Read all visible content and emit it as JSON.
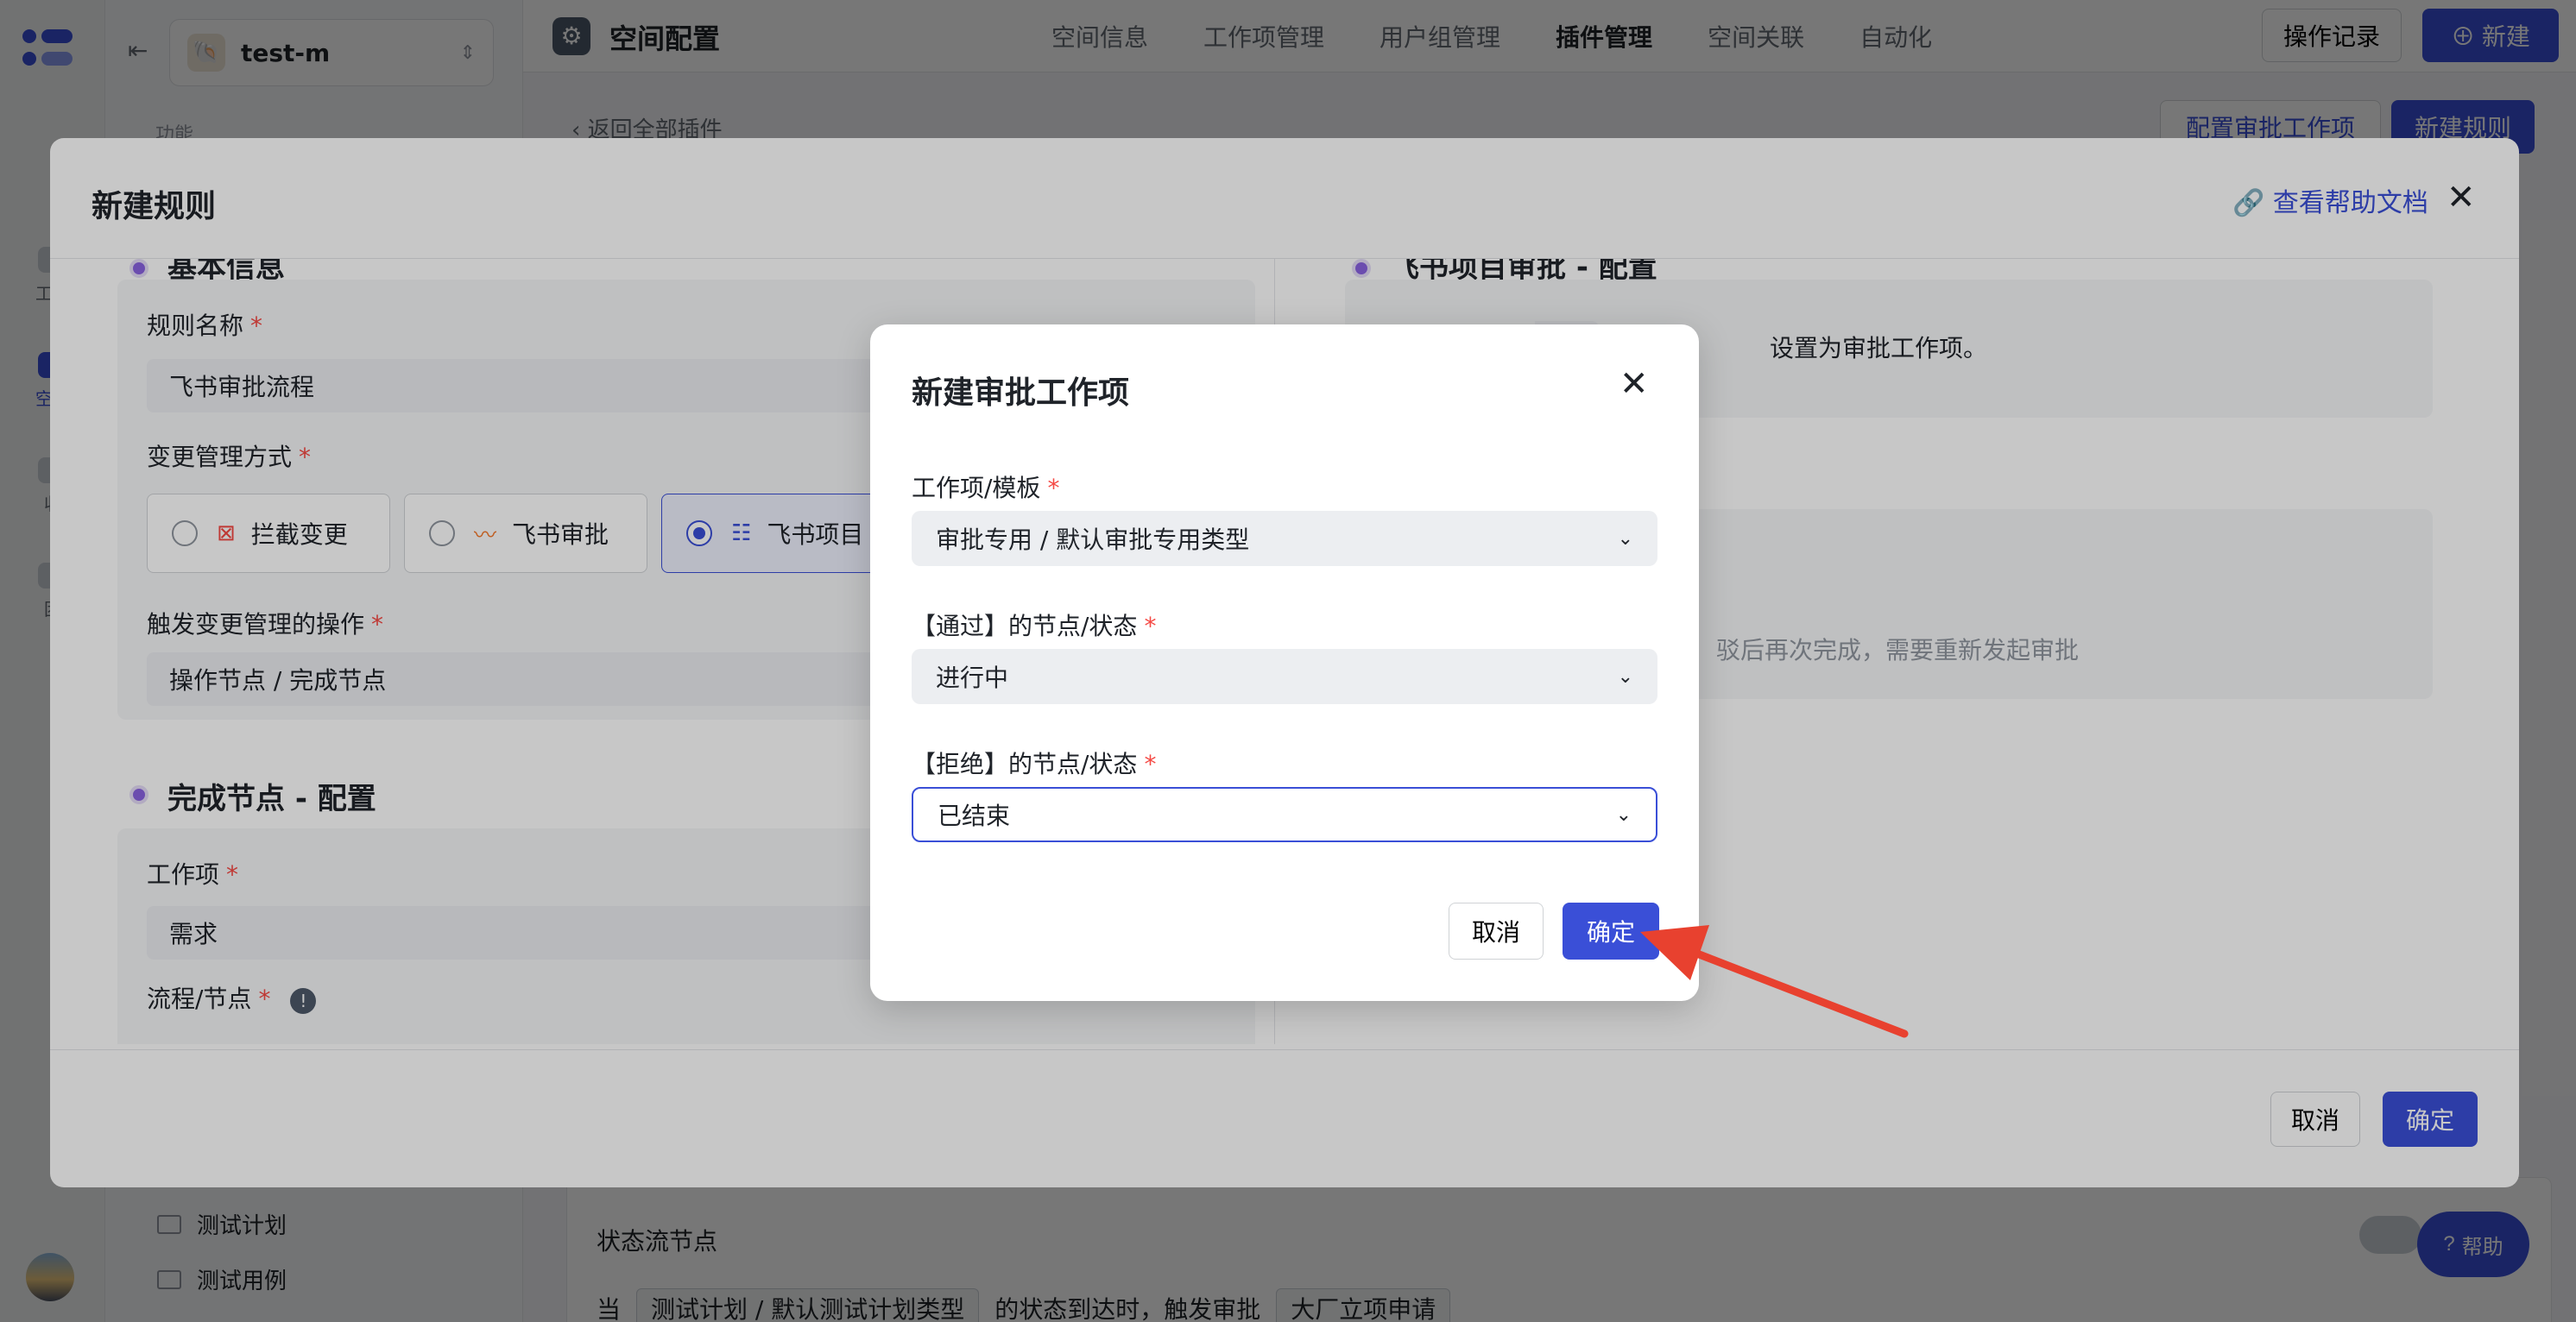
{
  "sidebar": {
    "space_name": "test-m",
    "section_label": "功能",
    "rail_items": [
      "工作",
      "空间",
      "收",
      "团"
    ],
    "tree_items": [
      "测试计划",
      "测试用例"
    ]
  },
  "topbar": {
    "title": "空间配置",
    "tabs": [
      "空间信息",
      "工作项管理",
      "用户组管理",
      "插件管理",
      "空间关联",
      "自动化"
    ],
    "active_tab": "插件管理",
    "log_button": "操作记录",
    "new_button": "新建"
  },
  "crumb": {
    "back": "返回全部插件",
    "config_button": "配置审批工作项",
    "new_rule_button": "新建规则"
  },
  "background_rule": {
    "heading": "状态流节点",
    "sentence_prefix": "当",
    "tag1": "测试计划 / 默认测试计划类型",
    "sentence_mid": "的状态到达时，触发审批",
    "tag2": "大厂立项申请"
  },
  "help_button": "帮助",
  "rule_dialog": {
    "title": "新建规则",
    "help_link": "查看帮助文档",
    "basic_section": "基本信息",
    "rule_name_label": "规则名称",
    "rule_name_value": "飞书审批流程",
    "change_mode_label": "变更管理方式",
    "mode_options": [
      "拦截变更",
      "飞书审批",
      "飞书项目"
    ],
    "selected_mode": "飞书项目",
    "trigger_label": "触发变更管理的操作",
    "trigger_value": "操作节点 / 完成节点",
    "complete_section": "完成节点 - 配置",
    "work_item_label": "工作项",
    "work_item_value": "需求",
    "flow_node_label": "流程/节点",
    "right_section": "飞书项目审批 - 配置",
    "right_text1": "设置为审批工作项。",
    "right_text2": "驳后再次完成，需要重新发起审批",
    "cancel": "取消",
    "confirm": "确定"
  },
  "approval_dialog": {
    "title": "新建审批工作项",
    "template_label": "工作项/模板",
    "template_value": "审批专用 / 默认审批专用类型",
    "pass_label": "【通过】的节点/状态",
    "pass_value": "进行中",
    "reject_label": "【拒绝】的节点/状态",
    "reject_value": "已结束",
    "cancel": "取消",
    "confirm": "确定"
  },
  "colors": {
    "primary": "#3a4fd7",
    "required": "#f54a45",
    "section_dot": "#8a62e0",
    "annotation_arrow": "#e8412f"
  }
}
